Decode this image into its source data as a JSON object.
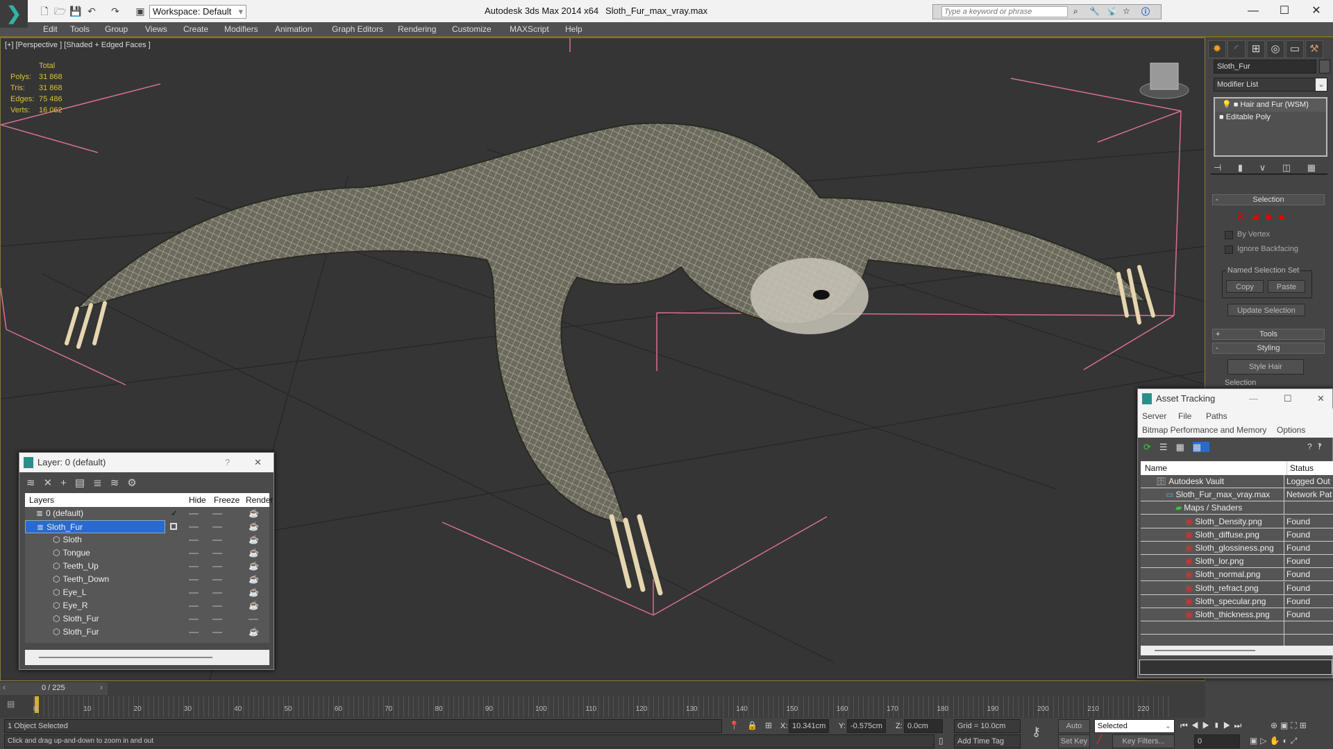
{
  "titlebar": {
    "workspace": "Workspace: Default",
    "app_title": "Autodesk 3ds Max  2014 x64",
    "file_title": "Sloth_Fur_max_vray.max",
    "search_placeholder": "Type a keyword or phrase",
    "minimize": "—",
    "maximize": "☐",
    "close": "✕"
  },
  "menu": [
    "Edit",
    "Tools",
    "Group",
    "Views",
    "Create",
    "Modifiers",
    "Animation",
    "Graph Editors",
    "Rendering",
    "Customize",
    "MAXScript",
    "Help"
  ],
  "viewport": {
    "label": "[+] [Perspective ] [Shaded + Edged Faces ]",
    "stats_header": "Total",
    "stats": [
      {
        "label": "Polys:",
        "value": "31 868"
      },
      {
        "label": "Tris:",
        "value": "31 868"
      },
      {
        "label": "Edges:",
        "value": "75 486"
      },
      {
        "label": "Verts:",
        "value": "16 062"
      }
    ],
    "colors": {
      "bbox": "#d8708f",
      "mesh": "#6b6a5c",
      "wire": "#e8e8e0"
    }
  },
  "command_panel": {
    "object_name": "Sloth_Fur",
    "modifier_list": "Modifier List",
    "stack": [
      "Hair and Fur (WSM)",
      "Editable Poly"
    ],
    "selection_rollout": "Selection",
    "by_vertex": "By Vertex",
    "ignore_backfacing": "Ignore Backfacing",
    "named_selection_set": "Named Selection Set",
    "copy": "Copy",
    "paste": "Paste",
    "update_selection": "Update Selection",
    "tools_rollout": "Tools",
    "styling_rollout": "Styling",
    "style_hair": "Style Hair",
    "selection_group": "Selection",
    "minus": "-",
    "plus": "+"
  },
  "layer_dialog": {
    "title": "Layer: 0 (default)",
    "help": "?",
    "close": "✕",
    "columns": {
      "layers": "Layers",
      "hide": "Hide",
      "freeze": "Freeze",
      "render": "Render"
    },
    "rows": [
      {
        "name": "0 (default)",
        "level": 0,
        "type": "layer",
        "current": true
      },
      {
        "name": "Sloth_Fur",
        "level": 0,
        "type": "layer",
        "selected": true
      },
      {
        "name": "Sloth",
        "level": 1,
        "type": "object"
      },
      {
        "name": "Tongue",
        "level": 1,
        "type": "object"
      },
      {
        "name": "Teeth_Up",
        "level": 1,
        "type": "object"
      },
      {
        "name": "Teeth_Down",
        "level": 1,
        "type": "object"
      },
      {
        "name": "Eye_L",
        "level": 1,
        "type": "object"
      },
      {
        "name": "Eye_R",
        "level": 1,
        "type": "object"
      },
      {
        "name": "Sloth_Fur",
        "level": 1,
        "type": "object",
        "render_off": true
      },
      {
        "name": "Sloth_Fur",
        "level": 1,
        "type": "object"
      }
    ]
  },
  "asset_tracking": {
    "title": "Asset Tracking",
    "menu": [
      "Server",
      "File",
      "Paths",
      "Bitmap Performance and Memory",
      "Options"
    ],
    "columns": {
      "name": "Name",
      "status": "Status"
    },
    "rows": [
      {
        "name": "Autodesk Vault",
        "status": "Logged Out ...",
        "level": 0,
        "icon": "vault"
      },
      {
        "name": "Sloth_Fur_max_vray.max",
        "status": "Network Path",
        "level": 1,
        "icon": "max"
      },
      {
        "name": "Maps / Shaders",
        "status": "",
        "level": 2,
        "icon": "maps"
      },
      {
        "name": "Sloth_Density.png",
        "status": "Found",
        "level": 3,
        "icon": "png"
      },
      {
        "name": "Sloth_diffuse.png",
        "status": "Found",
        "level": 3,
        "icon": "png"
      },
      {
        "name": "Sloth_glossiness.png",
        "status": "Found",
        "level": 3,
        "icon": "png"
      },
      {
        "name": "Sloth_lor.png",
        "status": "Found",
        "level": 3,
        "icon": "png"
      },
      {
        "name": "Sloth_normal.png",
        "status": "Found",
        "level": 3,
        "icon": "png"
      },
      {
        "name": "Sloth_refract.png",
        "status": "Found",
        "level": 3,
        "icon": "png"
      },
      {
        "name": "Sloth_specular.png",
        "status": "Found",
        "level": 3,
        "icon": "png"
      },
      {
        "name": "Sloth_thickness.png",
        "status": "Found",
        "level": 3,
        "icon": "png"
      }
    ]
  },
  "timeline": {
    "frame": "0 / 225",
    "ticks": [
      "0",
      "10",
      "20",
      "30",
      "40",
      "50",
      "60",
      "70",
      "80",
      "90",
      "100",
      "110",
      "120",
      "130",
      "140",
      "150",
      "160",
      "170",
      "180",
      "190",
      "200",
      "210",
      "220"
    ]
  },
  "status": {
    "selection": "1 Object Selected",
    "prompt": "Click and drag up-and-down to zoom in and out",
    "x_label": "X:",
    "x": "10.341cm",
    "y_label": "Y:",
    "y": "-0.575cm",
    "z_label": "Z:",
    "z": "0.0cm",
    "grid": "Grid = 10.0cm",
    "add_time_tag": "Add Time Tag",
    "auto_key": "Auto Key",
    "set_key": "Set Key",
    "key_mode": "Selected",
    "key_filters": "Key Filters...",
    "current_frame": "0"
  }
}
